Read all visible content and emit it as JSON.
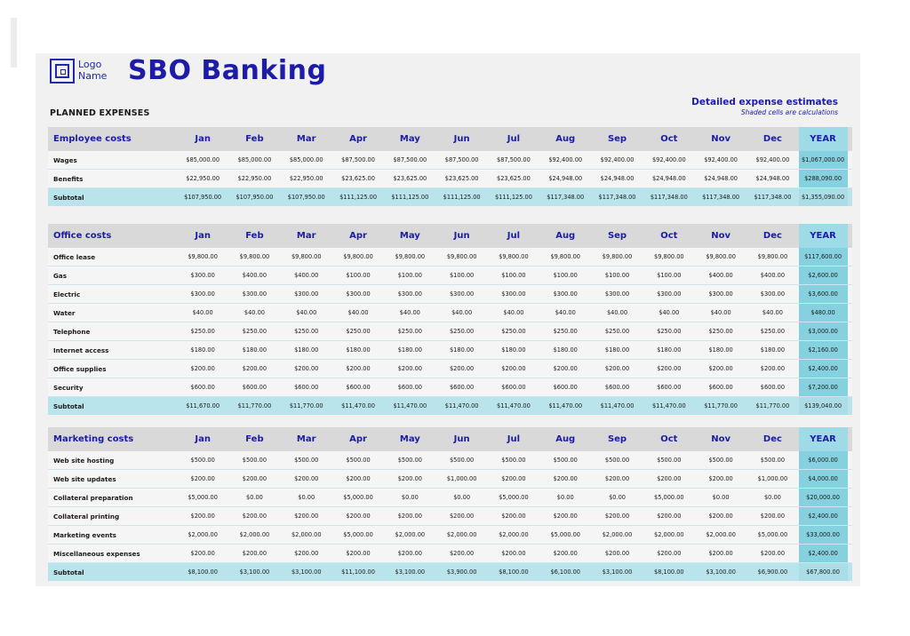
{
  "header": {
    "logo_line1": "Logo",
    "logo_line2": "Name",
    "brand": "SBO Banking",
    "planned": "PLANNED EXPENSES",
    "detail_title": "Detailed expense estimates",
    "detail_sub": "Shaded cells are calculations"
  },
  "months": [
    "Jan",
    "Feb",
    "Mar",
    "Apr",
    "May",
    "Jun",
    "Jul",
    "Aug",
    "Sep",
    "Oct",
    "Nov",
    "Dec",
    "YEAR"
  ],
  "sections": [
    {
      "title": "Employee costs",
      "rows": [
        {
          "label": "Wages",
          "values": [
            "$85,000.00",
            "$85,000.00",
            "$85,000.00",
            "$87,500.00",
            "$87,500.00",
            "$87,500.00",
            "$87,500.00",
            "$92,400.00",
            "$92,400.00",
            "$92,400.00",
            "$92,400.00",
            "$92,400.00",
            "$1,067,000.00"
          ]
        },
        {
          "label": "Benefits",
          "values": [
            "$22,950.00",
            "$22,950.00",
            "$22,950.00",
            "$23,625.00",
            "$23,625.00",
            "$23,625.00",
            "$23,625.00",
            "$24,948.00",
            "$24,948.00",
            "$24,948.00",
            "$24,948.00",
            "$24,948.00",
            "$288,090.00"
          ]
        }
      ],
      "subtotal": {
        "label": "Subtotal",
        "values": [
          "$107,950.00",
          "$107,950.00",
          "$107,950.00",
          "$111,125.00",
          "$111,125.00",
          "$111,125.00",
          "$111,125.00",
          "$117,348.00",
          "$117,348.00",
          "$117,348.00",
          "$117,348.00",
          "$117,348.00",
          "$1,355,090.00"
        ]
      }
    },
    {
      "title": "Office costs",
      "rows": [
        {
          "label": "Office lease",
          "values": [
            "$9,800.00",
            "$9,800.00",
            "$9,800.00",
            "$9,800.00",
            "$9,800.00",
            "$9,800.00",
            "$9,800.00",
            "$9,800.00",
            "$9,800.00",
            "$9,800.00",
            "$9,800.00",
            "$9,800.00",
            "$117,600.00"
          ]
        },
        {
          "label": "Gas",
          "values": [
            "$300.00",
            "$400.00",
            "$400.00",
            "$100.00",
            "$100.00",
            "$100.00",
            "$100.00",
            "$100.00",
            "$100.00",
            "$100.00",
            "$400.00",
            "$400.00",
            "$2,600.00"
          ]
        },
        {
          "label": "Electric",
          "values": [
            "$300.00",
            "$300.00",
            "$300.00",
            "$300.00",
            "$300.00",
            "$300.00",
            "$300.00",
            "$300.00",
            "$300.00",
            "$300.00",
            "$300.00",
            "$300.00",
            "$3,600.00"
          ]
        },
        {
          "label": "Water",
          "values": [
            "$40.00",
            "$40.00",
            "$40.00",
            "$40.00",
            "$40.00",
            "$40.00",
            "$40.00",
            "$40.00",
            "$40.00",
            "$40.00",
            "$40.00",
            "$40.00",
            "$480.00"
          ]
        },
        {
          "label": "Telephone",
          "values": [
            "$250.00",
            "$250.00",
            "$250.00",
            "$250.00",
            "$250.00",
            "$250.00",
            "$250.00",
            "$250.00",
            "$250.00",
            "$250.00",
            "$250.00",
            "$250.00",
            "$3,000.00"
          ]
        },
        {
          "label": "Internet access",
          "values": [
            "$180.00",
            "$180.00",
            "$180.00",
            "$180.00",
            "$180.00",
            "$180.00",
            "$180.00",
            "$180.00",
            "$180.00",
            "$180.00",
            "$180.00",
            "$180.00",
            "$2,160.00"
          ]
        },
        {
          "label": "Office supplies",
          "values": [
            "$200.00",
            "$200.00",
            "$200.00",
            "$200.00",
            "$200.00",
            "$200.00",
            "$200.00",
            "$200.00",
            "$200.00",
            "$200.00",
            "$200.00",
            "$200.00",
            "$2,400.00"
          ]
        },
        {
          "label": "Security",
          "values": [
            "$600.00",
            "$600.00",
            "$600.00",
            "$600.00",
            "$600.00",
            "$600.00",
            "$600.00",
            "$600.00",
            "$600.00",
            "$600.00",
            "$600.00",
            "$600.00",
            "$7,200.00"
          ]
        }
      ],
      "subtotal": {
        "label": "Subtotal",
        "values": [
          "$11,670.00",
          "$11,770.00",
          "$11,770.00",
          "$11,470.00",
          "$11,470.00",
          "$11,470.00",
          "$11,470.00",
          "$11,470.00",
          "$11,470.00",
          "$11,470.00",
          "$11,770.00",
          "$11,770.00",
          "$139,040.00"
        ]
      }
    },
    {
      "title": "Marketing costs",
      "rows": [
        {
          "label": "Web site hosting",
          "values": [
            "$500.00",
            "$500.00",
            "$500.00",
            "$500.00",
            "$500.00",
            "$500.00",
            "$500.00",
            "$500.00",
            "$500.00",
            "$500.00",
            "$500.00",
            "$500.00",
            "$6,000.00"
          ]
        },
        {
          "label": "Web site updates",
          "values": [
            "$200.00",
            "$200.00",
            "$200.00",
            "$200.00",
            "$200.00",
            "$1,000.00",
            "$200.00",
            "$200.00",
            "$200.00",
            "$200.00",
            "$200.00",
            "$1,000.00",
            "$4,000.00"
          ]
        },
        {
          "label": "Collateral preparation",
          "values": [
            "$5,000.00",
            "$0.00",
            "$0.00",
            "$5,000.00",
            "$0.00",
            "$0.00",
            "$5,000.00",
            "$0.00",
            "$0.00",
            "$5,000.00",
            "$0.00",
            "$0.00",
            "$20,000.00"
          ]
        },
        {
          "label": "Collateral printing",
          "values": [
            "$200.00",
            "$200.00",
            "$200.00",
            "$200.00",
            "$200.00",
            "$200.00",
            "$200.00",
            "$200.00",
            "$200.00",
            "$200.00",
            "$200.00",
            "$200.00",
            "$2,400.00"
          ]
        },
        {
          "label": "Marketing events",
          "values": [
            "$2,000.00",
            "$2,000.00",
            "$2,000.00",
            "$5,000.00",
            "$2,000.00",
            "$2,000.00",
            "$2,000.00",
            "$5,000.00",
            "$2,000.00",
            "$2,000.00",
            "$2,000.00",
            "$5,000.00",
            "$33,000.00"
          ]
        },
        {
          "label": "Miscellaneous expenses",
          "values": [
            "$200.00",
            "$200.00",
            "$200.00",
            "$200.00",
            "$200.00",
            "$200.00",
            "$200.00",
            "$200.00",
            "$200.00",
            "$200.00",
            "$200.00",
            "$200.00",
            "$2,400.00"
          ]
        }
      ],
      "subtotal": {
        "label": "Subtotal",
        "values": [
          "$8,100.00",
          "$3,100.00",
          "$3,100.00",
          "$11,100.00",
          "$3,100.00",
          "$3,900.00",
          "$8,100.00",
          "$6,100.00",
          "$3,100.00",
          "$8,100.00",
          "$3,100.00",
          "$6,900.00",
          "$67,800.00"
        ]
      }
    }
  ]
}
